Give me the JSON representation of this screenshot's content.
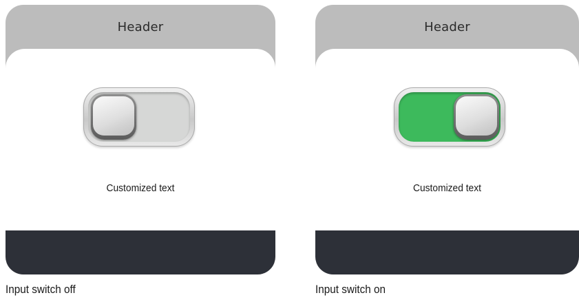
{
  "panels": [
    {
      "header": "Header",
      "switch": {
        "state": "off",
        "track_color": "#d6d7d6"
      },
      "text": "Customized text",
      "caption": "Input switch off"
    },
    {
      "header": "Header",
      "switch": {
        "state": "on",
        "track_color": "#3dba5c"
      },
      "text": "Customized text",
      "caption": "Input switch on"
    }
  ],
  "colors": {
    "header_bg": "#bcbcbc",
    "footer_bg": "#2d3038",
    "on_accent": "#3dba5c"
  }
}
